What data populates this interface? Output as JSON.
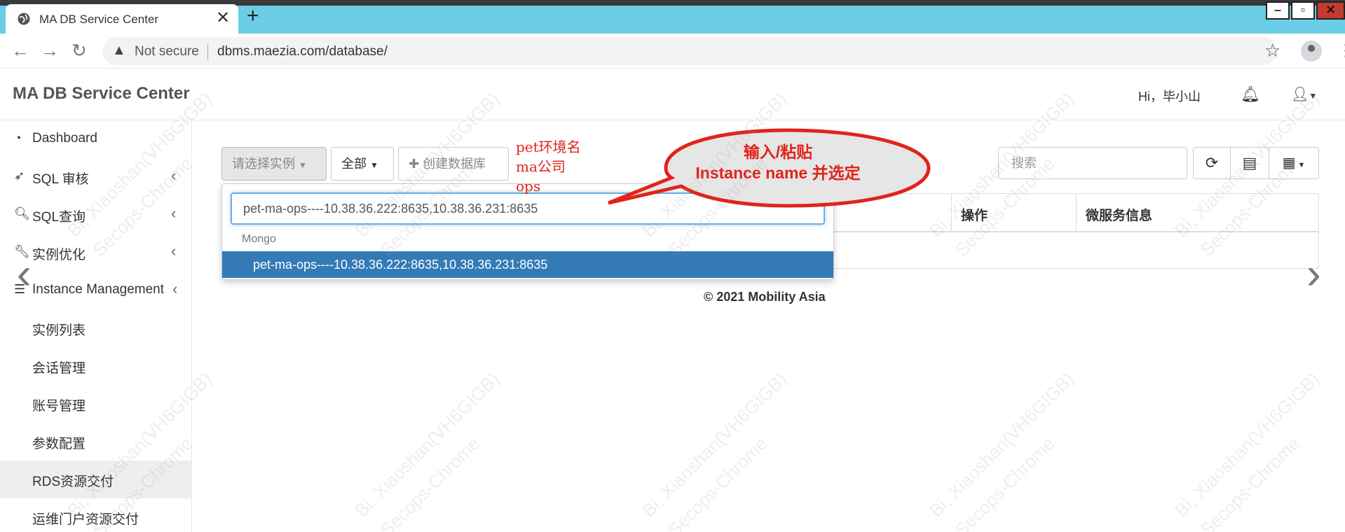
{
  "browser": {
    "tab_title": "MA DB Service Center",
    "tab_close": "✕",
    "new_tab": "+",
    "security": "Not secure",
    "url": "dbms.maezia.com/database/"
  },
  "header": {
    "brand": "MA DB Service Center",
    "greeting": "Hi，毕小山"
  },
  "sidebar": {
    "items": [
      {
        "label": "Dashboard",
        "icon": "dashboard-icon"
      },
      {
        "label": "SQL 审核",
        "icon": "rocket-icon"
      },
      {
        "label": "SQL查询",
        "icon": "search-icon"
      },
      {
        "label": "实例优化",
        "icon": "wrench-icon"
      },
      {
        "label": "Instance Management",
        "icon": "database-icon"
      },
      {
        "label": "实例列表"
      },
      {
        "label": "会话管理"
      },
      {
        "label": "账号管理"
      },
      {
        "label": "参数配置"
      },
      {
        "label": "RDS资源交付"
      },
      {
        "label": "运维门户资源交付"
      }
    ]
  },
  "toolbar": {
    "select_instance": "请选择实例",
    "all": "全部",
    "create_db": "创建数据库",
    "search_placeholder": "搜索"
  },
  "table": {
    "headers": [
      "操作",
      "微服务信息"
    ]
  },
  "dropdown": {
    "input_value": "pet-ma-ops----10.38.36.222:8635,10.38.36.231:8635",
    "group": "Mongo",
    "option": "pet-ma-ops----10.38.36.222:8635,10.38.36.231:8635"
  },
  "annotation": {
    "note_lines": [
      "pet环境名",
      "ma公司",
      "ops"
    ],
    "callout_line1": "输入/粘贴",
    "callout_line2": "Instance name 并选定",
    "color": "#e0241b"
  },
  "footer": "© 2021 Mobility Asia",
  "watermark": [
    "Bi, Xiaoshan(VH6GIGB)",
    "Secops-Chrome"
  ]
}
